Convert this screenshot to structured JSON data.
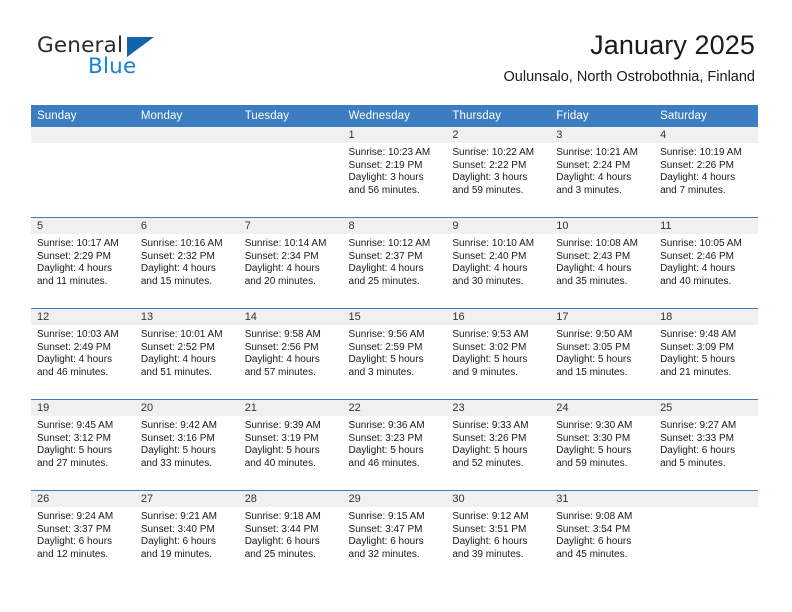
{
  "brand": {
    "word_one": "General",
    "word_two": "Blue",
    "logo_icon": "triangle-logo-icon"
  },
  "header": {
    "title": "January 2025",
    "subtitle": "Oulunsalo, North Ostrobothnia, Finland"
  },
  "colors": {
    "header_blue": "#3b7dc0",
    "daynum_band": "#f0f0f0",
    "brand_blue": "#1683d8",
    "logo_blue": "#1263ab",
    "text": "#1a1a1a"
  },
  "calendar": {
    "weekday_headers": [
      "Sunday",
      "Monday",
      "Tuesday",
      "Wednesday",
      "Thursday",
      "Friday",
      "Saturday"
    ],
    "weeks": [
      [
        {
          "day": "",
          "lines": []
        },
        {
          "day": "",
          "lines": []
        },
        {
          "day": "",
          "lines": []
        },
        {
          "day": "1",
          "lines": [
            "Sunrise: 10:23 AM",
            "Sunset: 2:19 PM",
            "Daylight: 3 hours",
            "and 56 minutes."
          ]
        },
        {
          "day": "2",
          "lines": [
            "Sunrise: 10:22 AM",
            "Sunset: 2:22 PM",
            "Daylight: 3 hours",
            "and 59 minutes."
          ]
        },
        {
          "day": "3",
          "lines": [
            "Sunrise: 10:21 AM",
            "Sunset: 2:24 PM",
            "Daylight: 4 hours",
            "and 3 minutes."
          ]
        },
        {
          "day": "4",
          "lines": [
            "Sunrise: 10:19 AM",
            "Sunset: 2:26 PM",
            "Daylight: 4 hours",
            "and 7 minutes."
          ]
        }
      ],
      [
        {
          "day": "5",
          "lines": [
            "Sunrise: 10:17 AM",
            "Sunset: 2:29 PM",
            "Daylight: 4 hours",
            "and 11 minutes."
          ]
        },
        {
          "day": "6",
          "lines": [
            "Sunrise: 10:16 AM",
            "Sunset: 2:32 PM",
            "Daylight: 4 hours",
            "and 15 minutes."
          ]
        },
        {
          "day": "7",
          "lines": [
            "Sunrise: 10:14 AM",
            "Sunset: 2:34 PM",
            "Daylight: 4 hours",
            "and 20 minutes."
          ]
        },
        {
          "day": "8",
          "lines": [
            "Sunrise: 10:12 AM",
            "Sunset: 2:37 PM",
            "Daylight: 4 hours",
            "and 25 minutes."
          ]
        },
        {
          "day": "9",
          "lines": [
            "Sunrise: 10:10 AM",
            "Sunset: 2:40 PM",
            "Daylight: 4 hours",
            "and 30 minutes."
          ]
        },
        {
          "day": "10",
          "lines": [
            "Sunrise: 10:08 AM",
            "Sunset: 2:43 PM",
            "Daylight: 4 hours",
            "and 35 minutes."
          ]
        },
        {
          "day": "11",
          "lines": [
            "Sunrise: 10:05 AM",
            "Sunset: 2:46 PM",
            "Daylight: 4 hours",
            "and 40 minutes."
          ]
        }
      ],
      [
        {
          "day": "12",
          "lines": [
            "Sunrise: 10:03 AM",
            "Sunset: 2:49 PM",
            "Daylight: 4 hours",
            "and 46 minutes."
          ]
        },
        {
          "day": "13",
          "lines": [
            "Sunrise: 10:01 AM",
            "Sunset: 2:52 PM",
            "Daylight: 4 hours",
            "and 51 minutes."
          ]
        },
        {
          "day": "14",
          "lines": [
            "Sunrise: 9:58 AM",
            "Sunset: 2:56 PM",
            "Daylight: 4 hours",
            "and 57 minutes."
          ]
        },
        {
          "day": "15",
          "lines": [
            "Sunrise: 9:56 AM",
            "Sunset: 2:59 PM",
            "Daylight: 5 hours",
            "and 3 minutes."
          ]
        },
        {
          "day": "16",
          "lines": [
            "Sunrise: 9:53 AM",
            "Sunset: 3:02 PM",
            "Daylight: 5 hours",
            "and 9 minutes."
          ]
        },
        {
          "day": "17",
          "lines": [
            "Sunrise: 9:50 AM",
            "Sunset: 3:05 PM",
            "Daylight: 5 hours",
            "and 15 minutes."
          ]
        },
        {
          "day": "18",
          "lines": [
            "Sunrise: 9:48 AM",
            "Sunset: 3:09 PM",
            "Daylight: 5 hours",
            "and 21 minutes."
          ]
        }
      ],
      [
        {
          "day": "19",
          "lines": [
            "Sunrise: 9:45 AM",
            "Sunset: 3:12 PM",
            "Daylight: 5 hours",
            "and 27 minutes."
          ]
        },
        {
          "day": "20",
          "lines": [
            "Sunrise: 9:42 AM",
            "Sunset: 3:16 PM",
            "Daylight: 5 hours",
            "and 33 minutes."
          ]
        },
        {
          "day": "21",
          "lines": [
            "Sunrise: 9:39 AM",
            "Sunset: 3:19 PM",
            "Daylight: 5 hours",
            "and 40 minutes."
          ]
        },
        {
          "day": "22",
          "lines": [
            "Sunrise: 9:36 AM",
            "Sunset: 3:23 PM",
            "Daylight: 5 hours",
            "and 46 minutes."
          ]
        },
        {
          "day": "23",
          "lines": [
            "Sunrise: 9:33 AM",
            "Sunset: 3:26 PM",
            "Daylight: 5 hours",
            "and 52 minutes."
          ]
        },
        {
          "day": "24",
          "lines": [
            "Sunrise: 9:30 AM",
            "Sunset: 3:30 PM",
            "Daylight: 5 hours",
            "and 59 minutes."
          ]
        },
        {
          "day": "25",
          "lines": [
            "Sunrise: 9:27 AM",
            "Sunset: 3:33 PM",
            "Daylight: 6 hours",
            "and 5 minutes."
          ]
        }
      ],
      [
        {
          "day": "26",
          "lines": [
            "Sunrise: 9:24 AM",
            "Sunset: 3:37 PM",
            "Daylight: 6 hours",
            "and 12 minutes."
          ]
        },
        {
          "day": "27",
          "lines": [
            "Sunrise: 9:21 AM",
            "Sunset: 3:40 PM",
            "Daylight: 6 hours",
            "and 19 minutes."
          ]
        },
        {
          "day": "28",
          "lines": [
            "Sunrise: 9:18 AM",
            "Sunset: 3:44 PM",
            "Daylight: 6 hours",
            "and 25 minutes."
          ]
        },
        {
          "day": "29",
          "lines": [
            "Sunrise: 9:15 AM",
            "Sunset: 3:47 PM",
            "Daylight: 6 hours",
            "and 32 minutes."
          ]
        },
        {
          "day": "30",
          "lines": [
            "Sunrise: 9:12 AM",
            "Sunset: 3:51 PM",
            "Daylight: 6 hours",
            "and 39 minutes."
          ]
        },
        {
          "day": "31",
          "lines": [
            "Sunrise: 9:08 AM",
            "Sunset: 3:54 PM",
            "Daylight: 6 hours",
            "and 45 minutes."
          ]
        },
        {
          "day": "",
          "lines": []
        }
      ]
    ]
  }
}
